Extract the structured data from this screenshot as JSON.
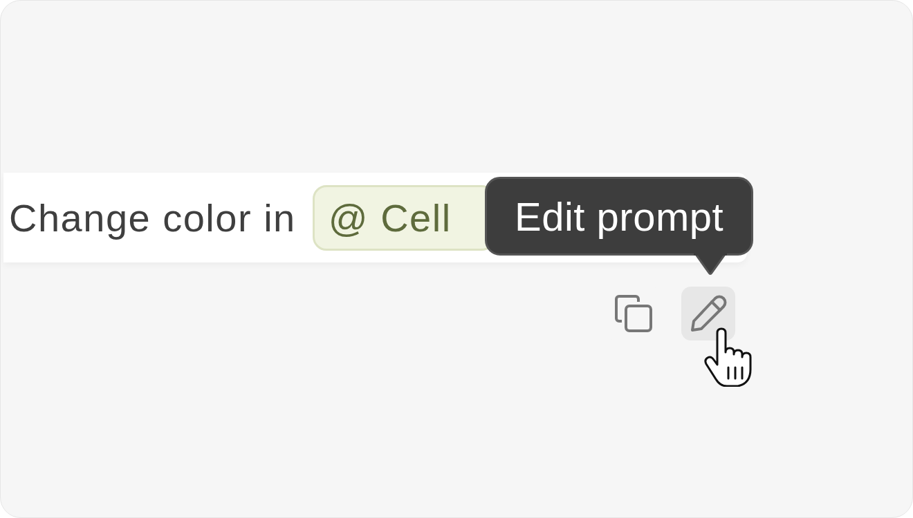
{
  "message": {
    "text": "Change color in",
    "mention": "@ Cell"
  },
  "actions": [
    {
      "kind": "copy",
      "hovered": false
    },
    {
      "kind": "edit",
      "hovered": true
    }
  ],
  "tooltip": {
    "text": "Edit prompt"
  }
}
